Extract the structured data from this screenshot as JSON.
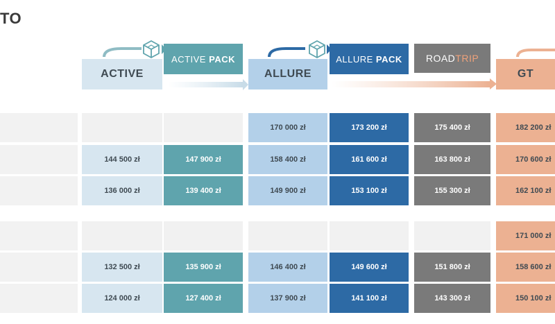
{
  "title": "TO",
  "trims": {
    "active": "ACTIVE",
    "active_pack_a": "ACTIVE",
    "active_pack_b": "PACK",
    "allure": "ALLURE",
    "allure_pack_a": "ALLURE",
    "allure_pack_b": "PACK",
    "roadtrip_a": "ROAD",
    "roadtrip_b": "TRIP",
    "gt": "GT"
  },
  "icons": {
    "upgrade": "cube-outline-icon"
  },
  "colors": {
    "active": "#d7e6f0",
    "active_pack": "#5fa4ad",
    "allure": "#b3d0e9",
    "allure_pack": "#2d6aa5",
    "roadtrip": "#7a7a7a",
    "roadtrip_accent": "#f0a27a",
    "gt": "#ecb192"
  },
  "group1": {
    "rows": [
      {
        "active": "",
        "active_pack": "",
        "allure": "170 000 zł",
        "allure_pack": "173 200 zł",
        "roadtrip": "175 400 zł",
        "gt": "182 200 zł"
      },
      {
        "active": "144 500 zł",
        "active_pack": "147 900 zł",
        "allure": "158 400 zł",
        "allure_pack": "161 600 zł",
        "roadtrip": "163 800 zł",
        "gt": "170 600 zł"
      },
      {
        "active": "136 000 zł",
        "active_pack": "139 400 zł",
        "allure": "149 900 zł",
        "allure_pack": "153 100 zł",
        "roadtrip": "155 300 zł",
        "gt": "162 100 zł"
      }
    ]
  },
  "group2": {
    "rows": [
      {
        "active": "",
        "active_pack": "",
        "allure": "",
        "allure_pack": "",
        "roadtrip": "",
        "gt": "171 000 zł"
      },
      {
        "active": "132 500 zł",
        "active_pack": "135 900 zł",
        "allure": "146 400 zł",
        "allure_pack": "149 600 zł",
        "roadtrip": "151 800 zł",
        "gt": "158 600 zł"
      },
      {
        "active": "124 000 zł",
        "active_pack": "127 400 zł",
        "allure": "137 900 zł",
        "allure_pack": "141 100 zł",
        "roadtrip": "143 300 zł",
        "gt": "150 100 zł"
      }
    ]
  }
}
